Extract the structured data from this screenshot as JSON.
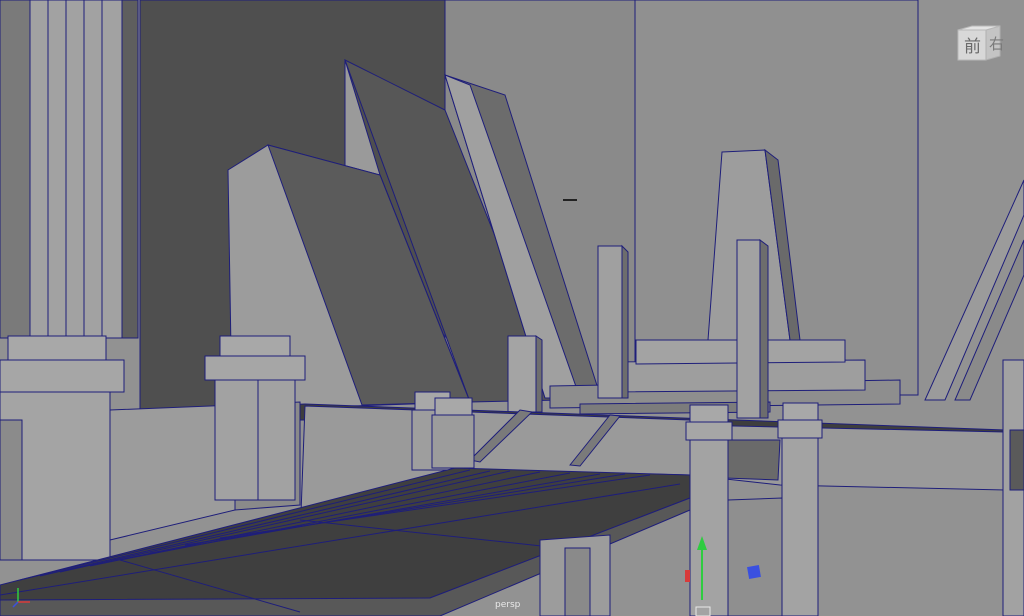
{
  "viewport": {
    "camera_label": "persp",
    "view_cube_label": "前",
    "view_cube_side_label": "右"
  },
  "colors": {
    "background": "#8f8f8f",
    "wire": "#1e1e7a",
    "ground_line": "#3bd08a",
    "gizmo_y": "#2ecc40",
    "gizmo_x": "#d83a3a",
    "gizmo_z": "#3a50e0"
  },
  "icons": [
    "view-cube-icon",
    "axis-gizmo-icon",
    "move-manipulator-icon"
  ]
}
